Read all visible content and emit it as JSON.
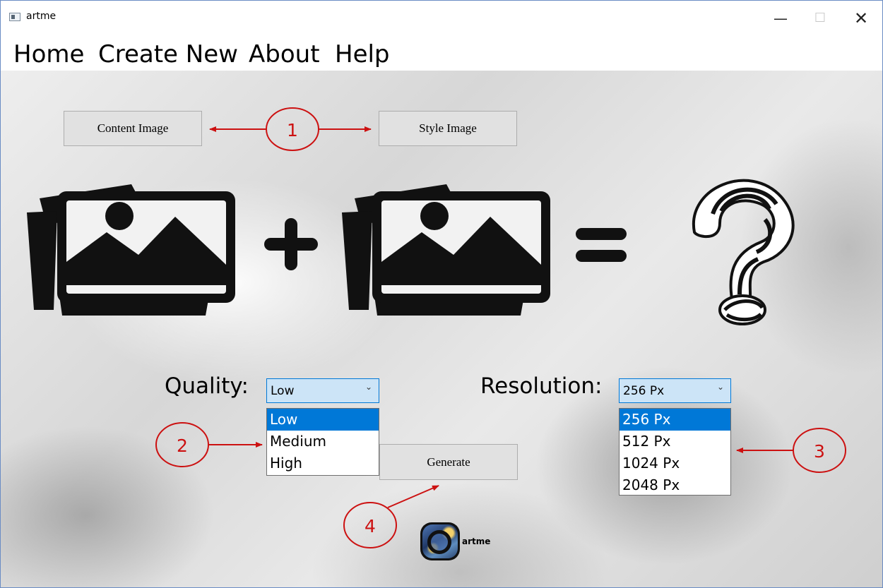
{
  "window": {
    "title": "artme",
    "minimize_icon": "minimize-icon",
    "maximize_icon": "maximize-icon",
    "close_icon": "close-icon"
  },
  "menu": {
    "items": [
      {
        "label": "Home"
      },
      {
        "label": "Create New"
      },
      {
        "label": "About"
      },
      {
        "label": "Help"
      }
    ]
  },
  "main": {
    "content_image_button": "Content Image",
    "style_image_button": "Style Image",
    "plus_sign": "+",
    "equals_sign": "=",
    "question_mark": "?",
    "quality": {
      "label": "Quality:",
      "selected": "Low",
      "options": [
        "Low",
        "Medium",
        "High"
      ]
    },
    "resolution": {
      "label": "Resolution:",
      "selected": "256 Px",
      "options": [
        "256 Px",
        "512 Px",
        "1024 Px",
        "2048 Px"
      ]
    },
    "generate_button": "Generate",
    "logo_text": "artme"
  },
  "annotations": {
    "callouts": [
      "1",
      "2",
      "3",
      "4"
    ],
    "color": "#cc1111"
  },
  "colors": {
    "accent": "#0078d7",
    "combo_bg": "#cce4f7",
    "button_bg": "#e1e1e1"
  }
}
